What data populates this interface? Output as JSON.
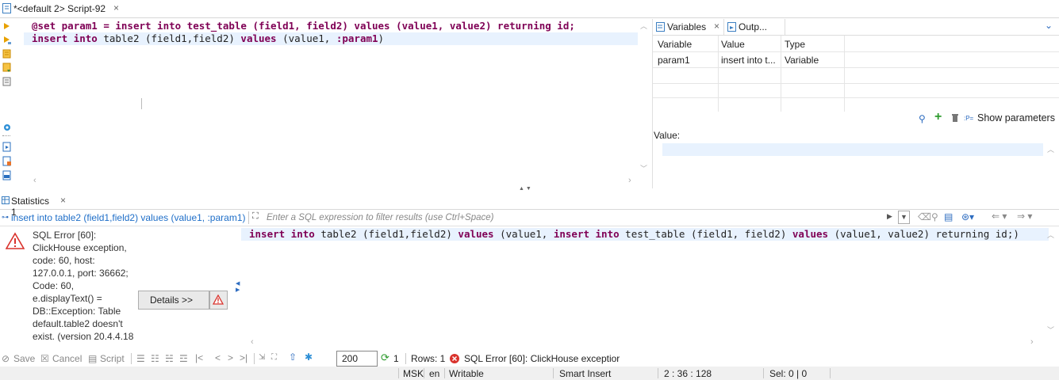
{
  "editor": {
    "tab_title": "*<default 2> Script-92",
    "line1": {
      "cmd": "@set",
      "var": "param1",
      "eq": " = ",
      "kw1": "insert into",
      "t1": " test_table ",
      "t2": "(field1, field2) ",
      "kw2": "values",
      "t3": " (value1, value2) ",
      "kw3": "returning",
      "t4": " id;"
    },
    "line2": {
      "kw1": "insert into",
      "t1": " table2 (field1,field2) ",
      "kw2": "values",
      "t2": " (value1, ",
      "param": ":param1",
      "t3": ")"
    }
  },
  "variables_panel": {
    "tab_variables": "Variables",
    "tab_output": "Outp...",
    "columns": [
      "Variable",
      "Value",
      "Type"
    ],
    "rows": [
      {
        "variable": "param1",
        "value": "insert into t...",
        "type": "Variable"
      }
    ],
    "show_parameters": "Show parameters",
    "value_label": "Value:"
  },
  "results": {
    "tab_title": "Statistics 1",
    "query_text": "insert into table2 (field1,field2) values (value1, :param1)",
    "filter_placeholder": "Enter a SQL expression to filter results (use Ctrl+Space)",
    "error_lines": [
      "SQL Error [60]:",
      "ClickHouse exception,",
      "code: 60, host:",
      "127.0.0.1, port: 36662;",
      "Code: 60,",
      "e.displayText() =",
      "DB::Exception: Table",
      "default.table2 doesn't",
      "exist. (version 20.4.4.18"
    ],
    "details_button": "Details >>",
    "result_line": {
      "kw1": "insert into",
      "t1": " table2 (field1,field2) ",
      "kw2": "values",
      "t2": " (value1, ",
      "kw3": "insert into",
      "t3": " test_table (field1, field2) ",
      "kw4": "values",
      "t4": " (value1, value2) returning id;)"
    }
  },
  "toolbar": {
    "save": "Save",
    "cancel": "Cancel",
    "script": "Script",
    "fetch_size": "200",
    "count": "1",
    "rows": "Rows: 1",
    "status_error": "SQL Error [60]: ClickHouse exceptior"
  },
  "statusbar": {
    "timezone": "MSK",
    "locale": "en",
    "mode": "Writable",
    "insert_mode": "Smart Insert",
    "position": "2 : 36 : 128",
    "selection": "Sel: 0 | 0"
  },
  "colors": {
    "accent_blue": "#1e6ec8",
    "keyword": "#7f0055",
    "error_red": "#d9322c",
    "current_line": "#e8f2fe"
  }
}
